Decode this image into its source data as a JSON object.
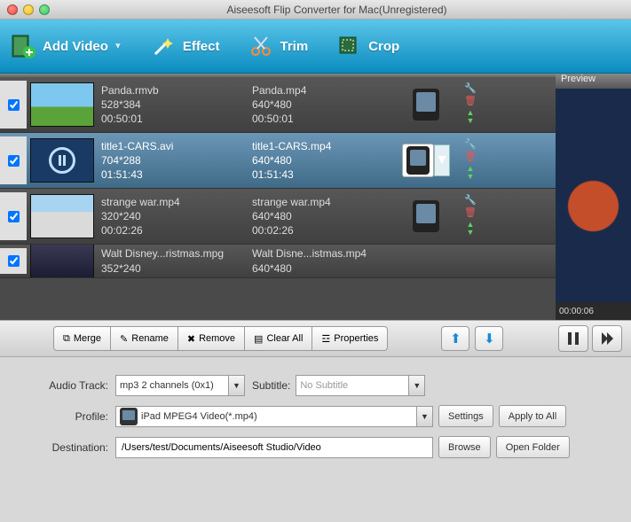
{
  "window": {
    "title": "Aiseesoft Flip Converter for Mac(Unregistered)"
  },
  "toolbar": {
    "add_video": "Add Video",
    "effect": "Effect",
    "trim": "Trim",
    "crop": "Crop"
  },
  "preview": {
    "label": "Preview",
    "time": "00:00:06"
  },
  "files": [
    {
      "checked": true,
      "src_name": "Panda.rmvb",
      "src_res": "528*384",
      "src_dur": "00:50:01",
      "out_name": "Panda.mp4",
      "out_res": "640*480",
      "out_dur": "00:50:01"
    },
    {
      "checked": true,
      "src_name": "title1-CARS.avi",
      "src_res": "704*288",
      "src_dur": "01:51:43",
      "out_name": "title1-CARS.mp4",
      "out_res": "640*480",
      "out_dur": "01:51:43"
    },
    {
      "checked": true,
      "src_name": "strange war.mp4",
      "src_res": "320*240",
      "src_dur": "00:02:26",
      "out_name": "strange war.mp4",
      "out_res": "640*480",
      "out_dur": "00:02:26"
    },
    {
      "checked": true,
      "src_name": "Walt Disney...ristmas.mpg",
      "src_res": "352*240",
      "src_dur": "",
      "out_name": "Walt Disne...istmas.mp4",
      "out_res": "640*480",
      "out_dur": ""
    }
  ],
  "midbar": {
    "merge": "Merge",
    "rename": "Rename",
    "remove": "Remove",
    "clear_all": "Clear All",
    "properties": "Properties"
  },
  "form": {
    "audio_track_label": "Audio Track:",
    "audio_track_value": "mp3 2 channels (0x1)",
    "subtitle_label": "Subtitle:",
    "subtitle_placeholder": "No Subtitle",
    "profile_label": "Profile:",
    "profile_value": "iPad MPEG4 Video(*.mp4)",
    "settings": "Settings",
    "apply_all": "Apply to All",
    "destination_label": "Destination:",
    "destination_value": "/Users/test/Documents/Aiseesoft Studio/Video",
    "browse": "Browse",
    "open_folder": "Open Folder"
  }
}
